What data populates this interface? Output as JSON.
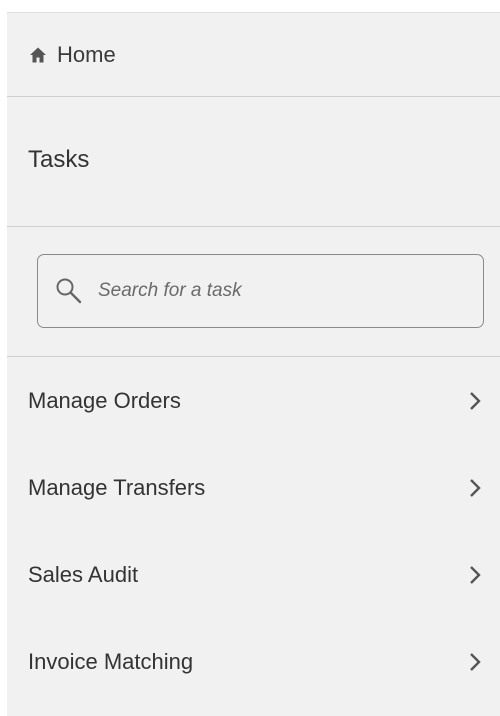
{
  "home": {
    "label": "Home",
    "icon": "home-icon"
  },
  "tasks": {
    "title": "Tasks"
  },
  "search": {
    "placeholder": "Search for a task",
    "value": "",
    "icon": "search-icon"
  },
  "menu": {
    "items": [
      {
        "label": "Manage Orders",
        "icon": "chevron-right-icon"
      },
      {
        "label": "Manage Transfers",
        "icon": "chevron-right-icon"
      },
      {
        "label": "Sales Audit",
        "icon": "chevron-right-icon"
      },
      {
        "label": "Invoice Matching",
        "icon": "chevron-right-icon"
      }
    ]
  },
  "colors": {
    "panel_background": "#f1f1f1",
    "divider": "#d0d0d0",
    "text": "#333333",
    "icon": "#555555"
  }
}
